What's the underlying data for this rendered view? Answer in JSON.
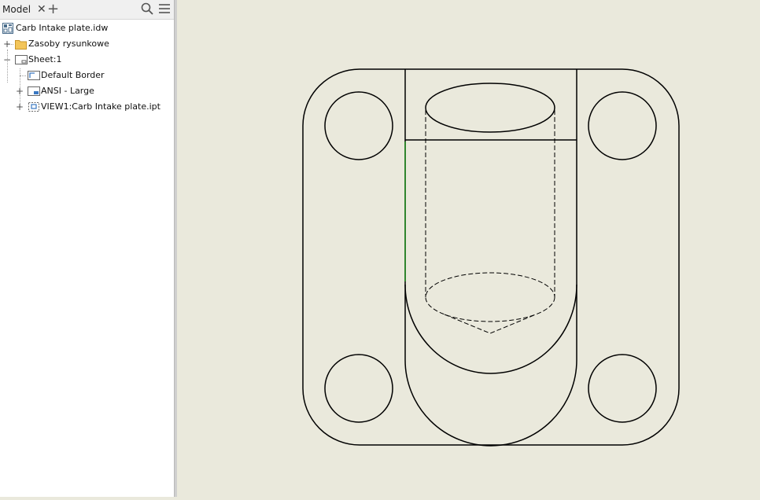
{
  "browser": {
    "tab_label": "Model",
    "close_icon": "close-icon",
    "add_icon": "plus-icon",
    "search_icon": "search-icon",
    "menu_icon": "hamburger-menu-icon",
    "tree": {
      "root": "Carb Intake plate.idw",
      "items": [
        {
          "label": "Zasoby rysunkowe",
          "icon": "folder-icon",
          "expander": "+"
        },
        {
          "label": "Sheet:1",
          "icon": "sheet-icon",
          "expander": "−"
        },
        {
          "label": "Default Border",
          "icon": "border-icon",
          "expander": ""
        },
        {
          "label": "ANSI - Large",
          "icon": "title-block-icon",
          "expander": "+"
        },
        {
          "label": "VIEW1:Carb Intake plate.ipt",
          "icon": "drawing-view-icon",
          "expander": "+"
        }
      ]
    }
  },
  "colors": {
    "canvas_bg": "#eae9dc",
    "line": "#000000",
    "highlight": "#1f8a1f"
  }
}
